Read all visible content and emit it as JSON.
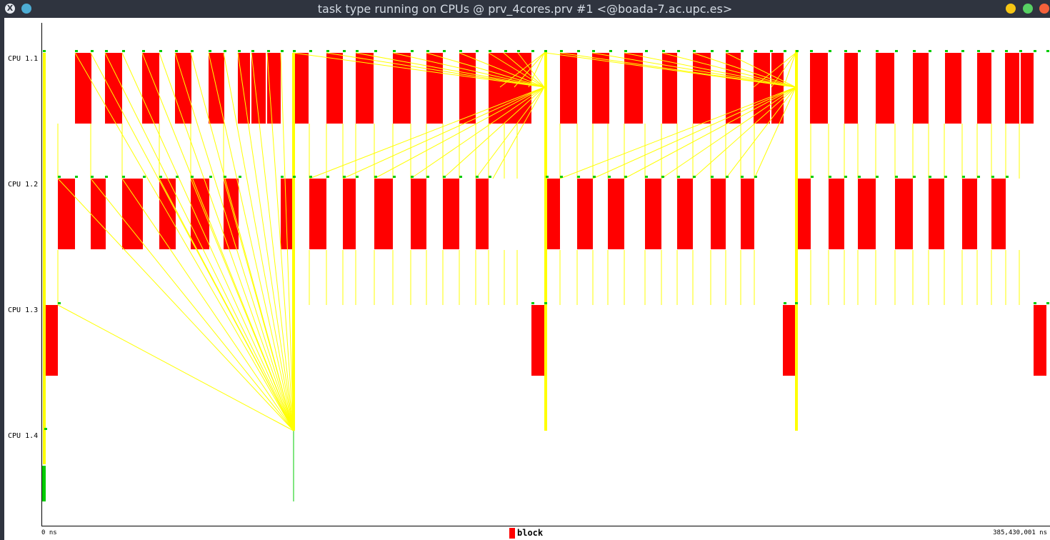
{
  "window": {
    "title": "task type running on CPUs @ prv_4cores.prv #1 <@boada-7.ac.upc.es>",
    "close_glyph": "X"
  },
  "timeline": {
    "rows": [
      "CPU 1.1",
      "CPU 1.2",
      "CPU 1.3",
      "CPU 1.4"
    ],
    "time_start": "0 ns",
    "time_end": "385,430,001 ns",
    "colors": {
      "block": "#ff0000",
      "comm": "#ffff00",
      "event": "#00cc00",
      "axis": "#000000"
    }
  },
  "legend": {
    "label": "block"
  },
  "chart_data": {
    "type": "timeline",
    "rows": [
      "CPU 1.1",
      "CPU 1.2",
      "CPU 1.3",
      "CPU 1.4"
    ],
    "state": "block",
    "time_range_ns": [
      0,
      385430001
    ]
  }
}
